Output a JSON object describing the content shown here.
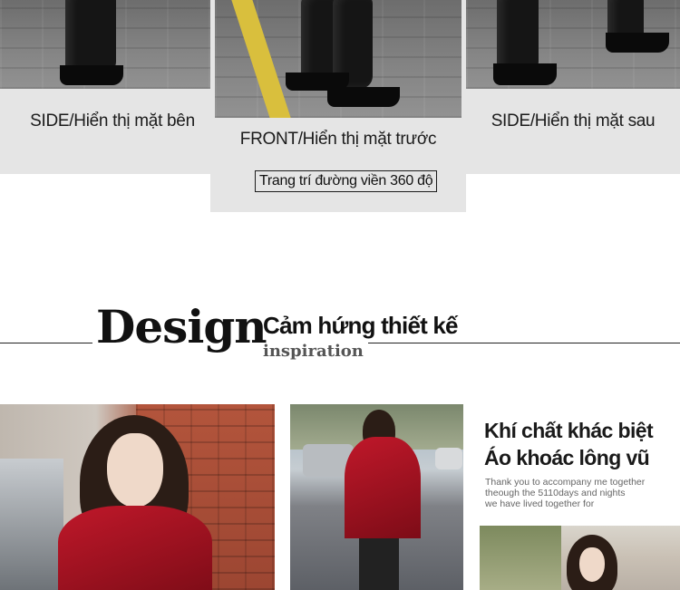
{
  "views": {
    "side_left": "SIDE/Hiển thị mặt bên",
    "front": "FRONT/Hiển thị mặt trước",
    "front_tag": "Trang trí đường viền 360 độ",
    "side_right": "SIDE/Hiển thị mặt sau"
  },
  "design": {
    "word": "Design",
    "vn": "Cảm hứng thiết kế",
    "en": "inspiration"
  },
  "feature": {
    "title_line1": "Khí chất khác biệt",
    "title_line2": "Áo khoác lông vũ",
    "body_line1": "Thank you to accompany me together",
    "body_line2": "theough the 5110days and nights",
    "body_line3": "we have lived together for"
  },
  "colors": {
    "panel_bg": "#e5e5e5",
    "jacket_red": "#c0182a",
    "text_dark": "#111111"
  }
}
